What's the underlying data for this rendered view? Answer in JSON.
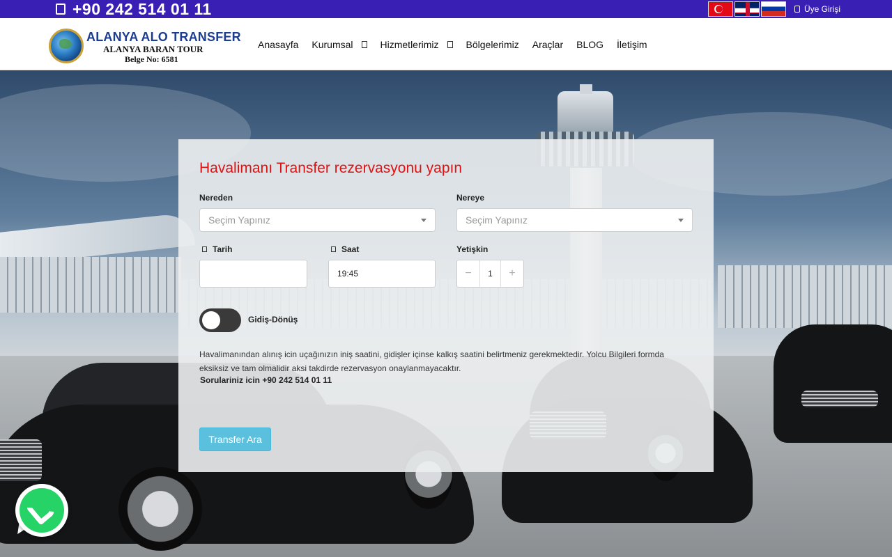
{
  "topbar": {
    "phone": "+90 242 514 01 11",
    "phone_icon": "phone-icon",
    "languages": [
      {
        "name": "flag-tr-icon"
      },
      {
        "name": "flag-uk-icon"
      },
      {
        "name": "flag-ru-icon"
      }
    ],
    "login_label": "Üye Girişi",
    "login_icon": "user-icon",
    "bg_color": "#3a1fb4"
  },
  "logo": {
    "name": "ALANYA ALO TRANSFER",
    "subtitle": "ALANYA BARAN TOUR",
    "certificate": "Belge No: 6581"
  },
  "nav": {
    "items": [
      {
        "label": "Anasayfa",
        "dropdown": false
      },
      {
        "label": "Kurumsal",
        "dropdown": true
      },
      {
        "label": "Hizmetlerimiz",
        "dropdown": true
      },
      {
        "label": "Bölgelerimiz",
        "dropdown": false
      },
      {
        "label": "Araçlar",
        "dropdown": false
      },
      {
        "label": "BLOG",
        "dropdown": false
      },
      {
        "label": "İletişim",
        "dropdown": false
      }
    ]
  },
  "booking": {
    "title": "Havalimanı Transfer rezervasyonu yapın",
    "from_label": "Nereden",
    "from_placeholder": "Seçim Yapınız",
    "to_label": "Nereye",
    "to_placeholder": "Seçim Yapınız",
    "date_label": "Tarih",
    "date_value": "",
    "time_label": "Saat",
    "time_value": "19:45",
    "adults_label": "Yetişkin",
    "adults_value": "1",
    "minus": "−",
    "plus": "+",
    "roundtrip_label": "Gidiş-Dönüş",
    "roundtrip_on": false,
    "info_text": "Havalimanından alınış icin uçağınızın iniş saatini, gidişler içinse kalkış saatini belirtmeniz gerekmektedir. Yolcu Bilgileri formda eksiksiz ve tam olmalidir aksi takdirde rezervasyon onaylanmayacaktır.",
    "info_question": "Sorulariniz icin +90 242 514 01 11",
    "search_button": "Transfer Ara",
    "title_color": "#e01111",
    "button_color": "#5bc0de"
  },
  "whatsapp": {
    "icon": "whatsapp-icon"
  }
}
